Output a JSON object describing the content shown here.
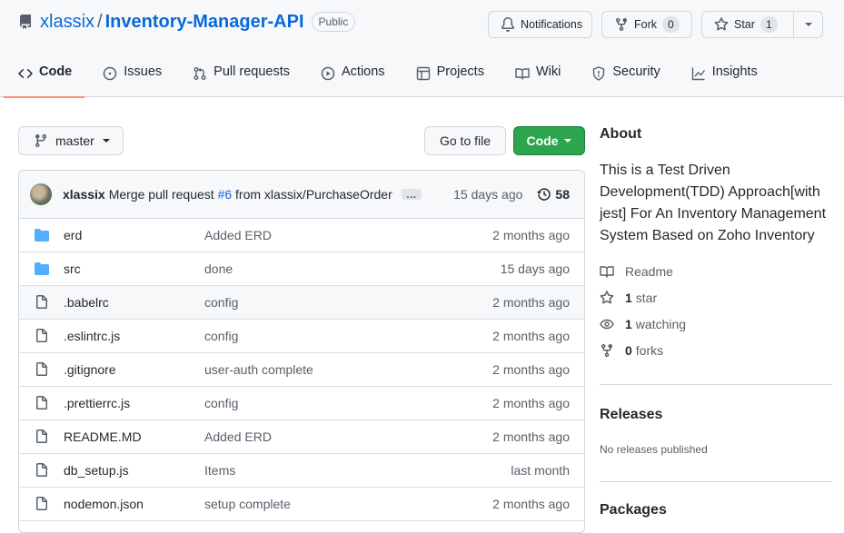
{
  "repo": {
    "owner": "xlassix",
    "separator": "/",
    "name": "Inventory-Manager-API",
    "visibility": "Public"
  },
  "actions": {
    "notifications_label": "Notifications",
    "fork_label": "Fork",
    "fork_count": "0",
    "star_label": "Star",
    "star_count": "1"
  },
  "tabs": [
    {
      "label": "Code",
      "icon": "code-icon",
      "active": true
    },
    {
      "label": "Issues",
      "icon": "issue-icon"
    },
    {
      "label": "Pull requests",
      "icon": "pull-request-icon"
    },
    {
      "label": "Actions",
      "icon": "play-icon"
    },
    {
      "label": "Projects",
      "icon": "table-icon"
    },
    {
      "label": "Wiki",
      "icon": "book-icon"
    },
    {
      "label": "Security",
      "icon": "shield-icon"
    },
    {
      "label": "Insights",
      "icon": "graph-icon"
    }
  ],
  "toolbar": {
    "branch": "master",
    "goto_file": "Go to file",
    "code": "Code"
  },
  "commit": {
    "author": "xlassix",
    "message_prefix": "Merge pull request",
    "pr_link": "#6",
    "message_suffix": "from xlassix/PurchaseOrder",
    "ellipsis": "…",
    "time": "15 days ago",
    "count": "58"
  },
  "files": [
    {
      "name": "erd",
      "type": "dir",
      "message": "Added ERD",
      "age": "2 months ago"
    },
    {
      "name": "src",
      "type": "dir",
      "message": "done",
      "age": "15 days ago"
    },
    {
      "name": ".babelrc",
      "type": "file",
      "message": "config",
      "age": "2 months ago"
    },
    {
      "name": ".eslintrc.js",
      "type": "file",
      "message": "config",
      "age": "2 months ago"
    },
    {
      "name": ".gitignore",
      "type": "file",
      "message": "user-auth complete",
      "age": "2 months ago"
    },
    {
      "name": ".prettierrc.js",
      "type": "file",
      "message": "config",
      "age": "2 months ago"
    },
    {
      "name": "README.MD",
      "type": "file",
      "message": "Added ERD",
      "age": "2 months ago"
    },
    {
      "name": "db_setup.js",
      "type": "file",
      "message": "Items",
      "age": "last month"
    },
    {
      "name": "nodemon.json",
      "type": "file",
      "message": "setup complete",
      "age": "2 months ago"
    }
  ],
  "about": {
    "title": "About",
    "description": "This is a Test Driven Development(TDD) Approach[with jest] For An Inventory Management System Based on Zoho Inventory",
    "readme": "Readme",
    "stars_count": "1",
    "stars_label": "star",
    "watching_count": "1",
    "watching_label": "watching",
    "forks_count": "0",
    "forks_label": "forks"
  },
  "releases": {
    "title": "Releases",
    "empty": "No releases published"
  },
  "packages": {
    "title": "Packages"
  },
  "colors": {
    "link": "#0969da",
    "code_button": "#2da44e",
    "tab_underline": "#fd8c73",
    "folder": "#54aeff"
  }
}
